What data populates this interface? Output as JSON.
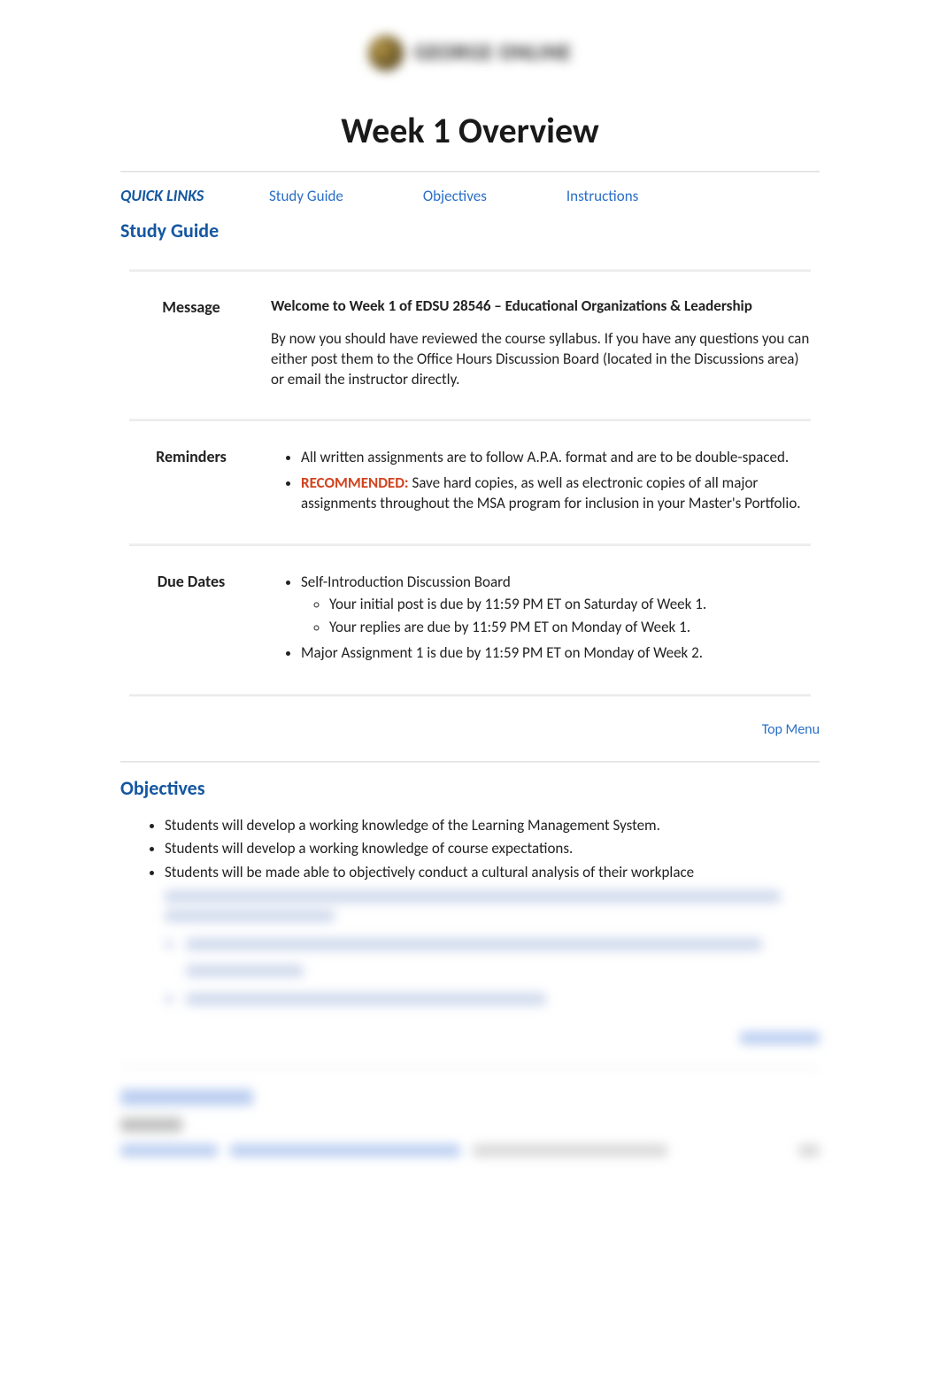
{
  "header": {
    "logo_text": "GEORGE ONLINE"
  },
  "title": "Week 1 Overview",
  "quicklinks": {
    "label": "QUICK LINKS",
    "items": [
      {
        "label": "Study Guide"
      },
      {
        "label": "Objectives"
      },
      {
        "label": "Instructions"
      }
    ]
  },
  "study_guide": {
    "heading": "Study Guide",
    "rows": {
      "message": {
        "label": "Message",
        "welcome": "Welcome to Week 1 of EDSU 28546 – Educational Organizations & Leadership",
        "body": "By now you should have reviewed the course syllabus. If you have any questions you can either post them to the Office Hours Discussion Board (located in the Discussions area) or email the instructor directly."
      },
      "reminders": {
        "label": "Reminders",
        "items": [
          {
            "text": "All written assignments are to follow A.P.A. format and are to be double-spaced."
          },
          {
            "prefix": "RECOMMENDED:",
            "text": " Save hard copies, as well as electronic copies of all major assignments throughout the MSA program for inclusion in your Master's Portfolio."
          }
        ]
      },
      "due_dates": {
        "label": "Due Dates",
        "items": [
          {
            "text": "Self-Introduction Discussion Board",
            "sub": [
              "Your initial post is due by 11:59 PM ET on Saturday of Week 1.",
              "Your replies are due by 11:59 PM ET on Monday of Week 1."
            ]
          },
          {
            "text": "Major Assignment 1 is due by 11:59 PM ET on Monday of Week 2."
          }
        ]
      }
    },
    "top_menu": "Top Menu"
  },
  "objectives": {
    "heading": "Objectives",
    "items": [
      "Students will develop a working knowledge of the Learning Management System.",
      "Students will develop a working knowledge of course expectations.",
      "Students will be made able to objectively conduct a cultural analysis of their workplace"
    ]
  }
}
